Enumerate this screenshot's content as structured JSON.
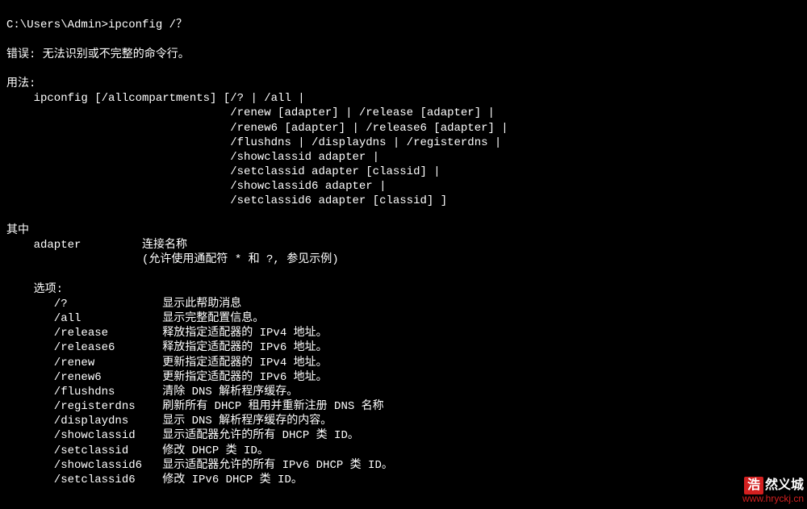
{
  "prompt": "C:\\Users\\Admin>ipconfig /？",
  "error": "错误: 无法识别或不完整的命令行。",
  "usage_label": "用法:",
  "usage_lines": [
    "    ipconfig [/allcompartments] [/? | /all |",
    "                                 /renew [adapter] | /release [adapter] |",
    "                                 /renew6 [adapter] | /release6 [adapter] |",
    "                                 /flushdns | /displaydns | /registerdns |",
    "                                 /showclassid adapter |",
    "                                 /setclassid adapter [classid] |",
    "                                 /showclassid6 adapter |",
    "                                 /setclassid6 adapter [classid] ]"
  ],
  "where_label": "其中",
  "adapter_label": "    adapter         连接名称",
  "adapter_note": "                    (允许使用通配符 * 和 ?, 参见示例)",
  "options_label": "    选项:",
  "options": [
    {
      "opt": "/?",
      "desc": "显示此帮助消息"
    },
    {
      "opt": "/all",
      "desc": "显示完整配置信息。"
    },
    {
      "opt": "/release",
      "desc": "释放指定适配器的 IPv4 地址。"
    },
    {
      "opt": "/release6",
      "desc": "释放指定适配器的 IPv6 地址。"
    },
    {
      "opt": "/renew",
      "desc": "更新指定适配器的 IPv4 地址。"
    },
    {
      "opt": "/renew6",
      "desc": "更新指定适配器的 IPv6 地址。"
    },
    {
      "opt": "/flushdns",
      "desc": "清除 DNS 解析程序缓存。"
    },
    {
      "opt": "/registerdns",
      "desc": "刷新所有 DHCP 租用并重新注册 DNS 名称"
    },
    {
      "opt": "/displaydns",
      "desc": "显示 DNS 解析程序缓存的内容。"
    },
    {
      "opt": "/showclassid",
      "desc": "显示适配器允许的所有 DHCP 类 ID。"
    },
    {
      "opt": "/setclassid",
      "desc": "修改 DHCP 类 ID。"
    },
    {
      "opt": "/showclassid6",
      "desc": "显示适配器允许的所有 IPv6 DHCP 类 ID。"
    },
    {
      "opt": "/setclassid6",
      "desc": "修改 IPv6 DHCP 类 ID。"
    }
  ],
  "watermark": {
    "icon": "浩",
    "text": "然义城",
    "url": "www.hryckj.cn"
  }
}
